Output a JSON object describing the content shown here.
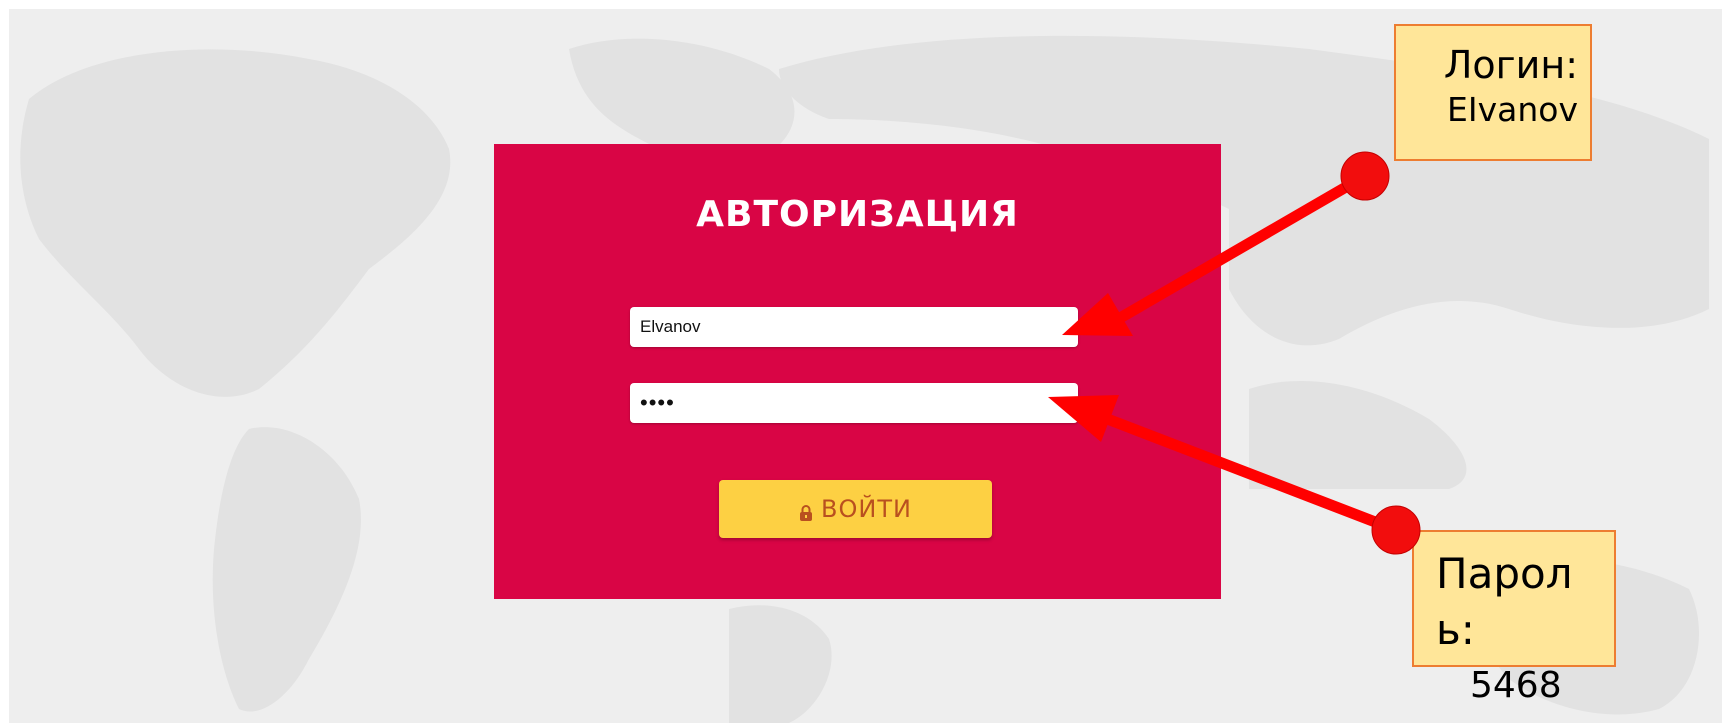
{
  "login_form": {
    "title": "АВТОРИЗАЦИЯ",
    "login_value": "Elvanov",
    "password_value": "••••",
    "submit_label": "ВОЙТИ",
    "submit_icon": "lock-icon"
  },
  "annotations": {
    "login_label": "Логин:",
    "login_value": "EIvanov",
    "password_label": "Пароль:",
    "password_value": "5468"
  },
  "colors": {
    "panel": "#d90545",
    "button": "#fdd043",
    "button_text": "#b9501f",
    "callout_fill": "#ffe699",
    "callout_border": "#ed7d31",
    "arrow": "#ff0000",
    "map_background": "#eeeeee",
    "map_land": "#e2e2e2"
  }
}
